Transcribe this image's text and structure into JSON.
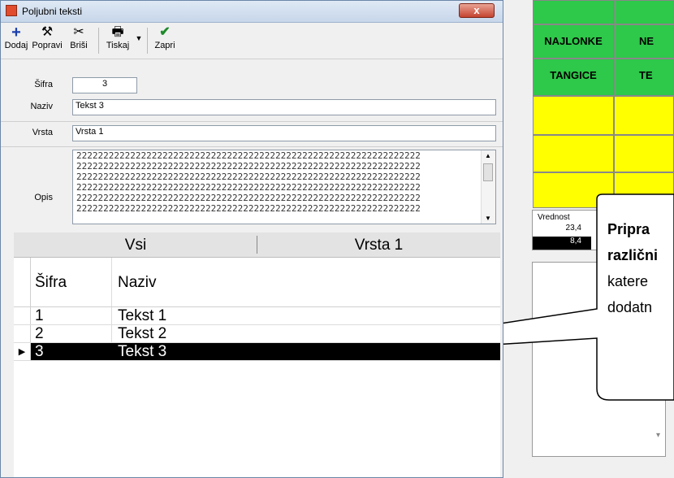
{
  "window": {
    "title": "Poljubni teksti",
    "close_label": "x"
  },
  "toolbar": {
    "buttons": [
      {
        "label": "Dodaj",
        "icon": "plus-icon"
      },
      {
        "label": "Popravi",
        "icon": "hammer-icon"
      },
      {
        "label": "Briši",
        "icon": "scissors-icon"
      },
      {
        "label": "Tiskaj",
        "icon": "printer-icon"
      },
      {
        "label": "Zapri",
        "icon": "checkmark-icon"
      }
    ]
  },
  "form": {
    "sifra_label": "Šifra",
    "sifra_value": "3",
    "naziv_label": "Naziv",
    "naziv_value": "Tekst 3",
    "vrsta_label": "Vrsta",
    "vrsta_value": "Vrsta 1",
    "opis_label": "Opis",
    "opis_lines": [
      "2222222222222222222222222222222222222222222222222222222222222222",
      "2222222222222222222222222222222222222222222222222222222222222222",
      "2222222222222222222222222222222222222222222222222222222222222222",
      "2222222222222222222222222222222222222222222222222222222222222222",
      "2222222222222222222222222222222222222222222222222222222222222222",
      "2222222222222222222222222222222222222222222222222222222222222222"
    ]
  },
  "tabs": [
    {
      "label": "Vsi"
    },
    {
      "label": "Vrsta 1"
    }
  ],
  "grid": {
    "headers": [
      "Šifra",
      "Naziv"
    ],
    "rows": [
      {
        "sifra": "1",
        "naziv": "Tekst 1"
      },
      {
        "sifra": "2",
        "naziv": "Tekst 2"
      },
      {
        "sifra": "3",
        "naziv": "Tekst 3",
        "selected": true
      }
    ]
  },
  "background": {
    "row1": [
      "NAJLONKE",
      "NE"
    ],
    "row2": [
      "TANGICE",
      "TE"
    ],
    "small_table": {
      "header": "Vrednost",
      "values": [
        "23,4",
        "8,4"
      ]
    }
  },
  "callout": {
    "line1": "Pripra",
    "line2": "različni",
    "line3": "katere",
    "line4": "dodatn"
  },
  "colors": {
    "green": "#2ec84a",
    "yellow": "#ffff00",
    "selection": "#000000"
  }
}
